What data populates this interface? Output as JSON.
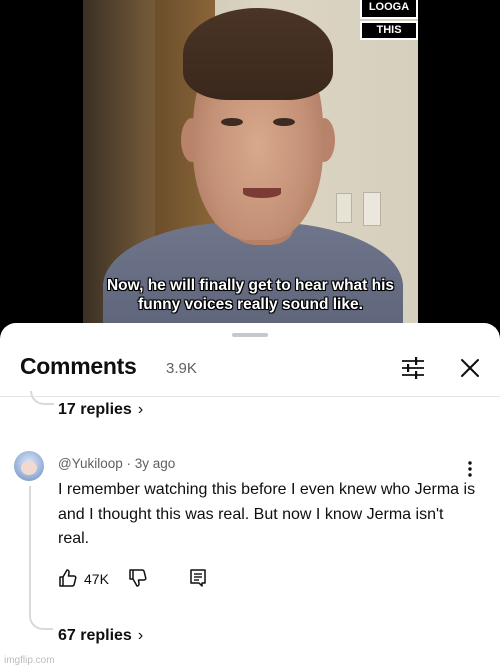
{
  "video": {
    "channel_logo": [
      "LOOGA",
      "THIS"
    ],
    "subtitle_lines": [
      "Now, he will finally get to hear what his",
      "funny voices really sound like."
    ]
  },
  "comments_sheet": {
    "title": "Comments",
    "count": "3.9K",
    "icons": {
      "filter": "sliders-icon",
      "close": "close-icon"
    }
  },
  "threads": [
    {
      "replies_label": "17 replies"
    },
    {
      "author": "@Yukiloop",
      "time": "· 3y ago",
      "text": "I remember watching this before I even knew who Jerma is and I thought this was real. But now I know Jerma isn't real.",
      "likes": "47K",
      "replies_label": "67 replies"
    }
  ],
  "watermark": "imgflip.com",
  "colors": {
    "sheet_bg": "#ffffff",
    "text": "#0f0f0f",
    "secondary": "#606060"
  }
}
